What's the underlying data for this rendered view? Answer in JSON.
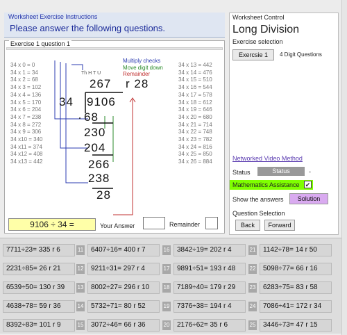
{
  "instructions": {
    "heading": "Worksheet Exercise Instructions",
    "text": "Please answer the following questions."
  },
  "exercise": {
    "title": "Exercise 1 question 1",
    "left_table": [
      "34 x 0 = 0",
      "34 x 1 = 34",
      "34 x 2 = 68",
      "34 x 3 = 102",
      "34 x 4 = 136",
      "34 x 5 = 170",
      "34 x 6 = 204",
      "34 x 7 = 238",
      "34 x 8 = 272",
      "34 x 9 = 306",
      "34 x10 = 340",
      "34 x11 = 374",
      "34 x12 = 408",
      "34 x13 = 442"
    ],
    "right_table": [
      "34 x 13 = 442",
      "34 x 14 = 476",
      "34 x 15 = 510",
      "34 x 16 = 544",
      "34 x 17 = 578",
      "34 x 18 = 612",
      "34 x 19 = 646",
      "34 x 20 = 680",
      "34 x 21 = 714",
      "34 x 22 = 748",
      "34 x 23 = 782",
      "34 x 24 = 816",
      "34 x 25 = 850",
      "34 x 26 = 884"
    ],
    "place_values": "Th H T U",
    "quotient": "267",
    "remainder_label": "r 28",
    "divisor": "34",
    "dividend": "9106",
    "steps": [
      "68",
      "230",
      "204",
      "266",
      "238",
      "28"
    ],
    "legend": {
      "multiply": "Multiply checks",
      "move": "Move digit down",
      "remainder": "Remainder"
    },
    "legend_colors": {
      "multiply": "#2b3bb0",
      "move": "#2a8a2a",
      "remainder": "#c03030"
    },
    "expression": "9106 ÷ 34 =",
    "your_answer_label": "Your Answer",
    "remainder_input_label": "Remainder",
    "answer_value": "",
    "remainder_value": ""
  },
  "control": {
    "title": "Worksheet Control",
    "heading": "Long Division",
    "selection_label": "Exercise selection",
    "exercise_button": "Exercsie 1",
    "digit_label": "4 Digit Questions",
    "video_link": "Networked Video Method",
    "status_label": "Status",
    "status_value": "Status",
    "status_dash": "-",
    "assistance_label": "Mathematics Assistance",
    "assistance_check": "✔",
    "show_answers_label": "Show the answers",
    "solution_button": "Solution",
    "question_selection_label": "Question Selection",
    "back_button": "Back",
    "forward_button": "Forward",
    "accent": "#7fff00"
  },
  "questions": [
    {
      "n": "",
      "q": "7711÷23= 335 r 6"
    },
    {
      "n": "11",
      "q": "6407÷16= 400 r 7"
    },
    {
      "n": "16",
      "q": "3842÷19= 202 r 4"
    },
    {
      "n": "21",
      "q": "1142÷78= 14 r 50"
    },
    {
      "n": "",
      "q": "2231÷85= 26 r 21"
    },
    {
      "n": "12",
      "q": "9211÷31= 297 r 4"
    },
    {
      "n": "17",
      "q": "9891÷51= 193 r 48"
    },
    {
      "n": "22",
      "q": "5098÷77= 66 r 16"
    },
    {
      "n": "",
      "q": "6539÷50= 130 r 39"
    },
    {
      "n": "13",
      "q": "8002÷27= 296 r 10"
    },
    {
      "n": "18",
      "q": "7189÷40= 179 r 29"
    },
    {
      "n": "23",
      "q": "6283÷75= 83 r 58"
    },
    {
      "n": "",
      "q": "4638÷78= 59 r 36"
    },
    {
      "n": "14",
      "q": "5732÷71= 80 r 52"
    },
    {
      "n": "19",
      "q": "7376÷38= 194 r 4"
    },
    {
      "n": "24",
      "q": "7086÷41= 172 r 34"
    },
    {
      "n": "",
      "q": "8392÷83= 101 r 9"
    },
    {
      "n": "15",
      "q": "3072÷46= 66 r 36"
    },
    {
      "n": "20",
      "q": "2176÷62= 35 r 6"
    },
    {
      "n": "25",
      "q": "3446÷73= 47 r 15"
    }
  ]
}
